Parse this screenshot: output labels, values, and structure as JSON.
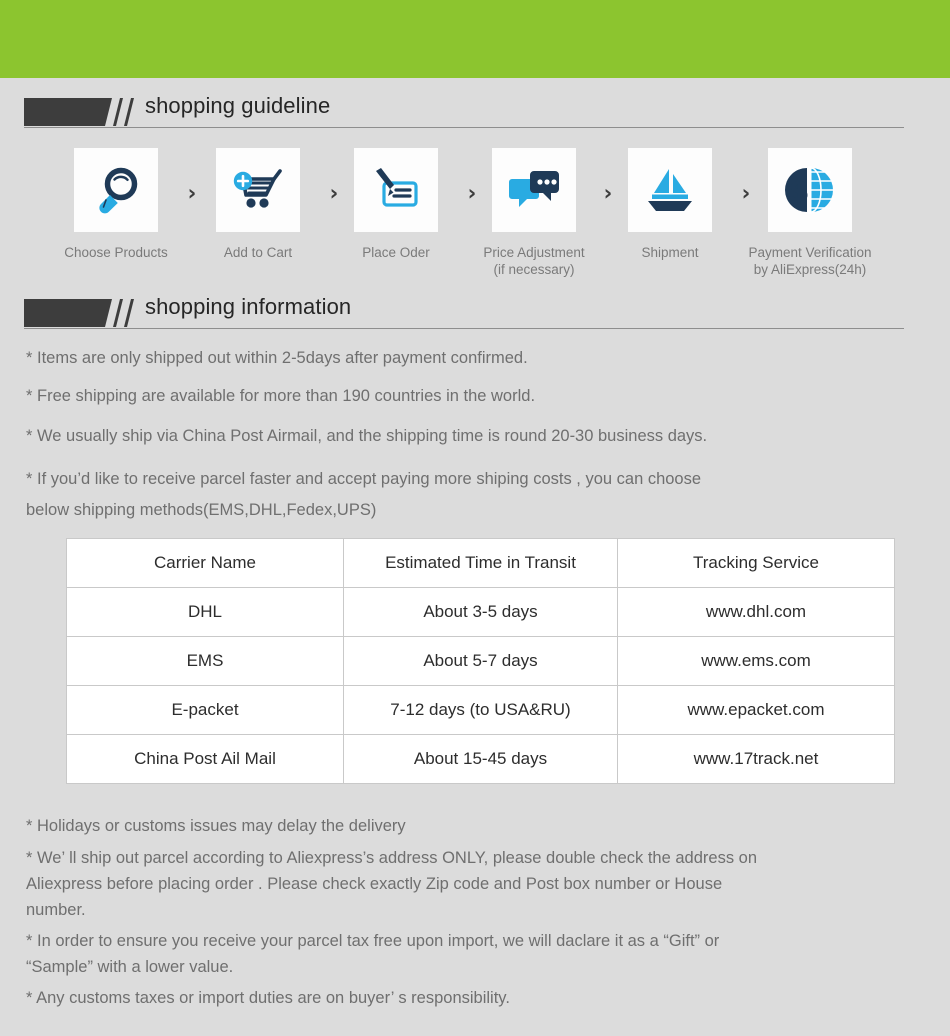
{
  "theme": {
    "banner_color": "#8cc52f",
    "background_color": "#dcdcdc",
    "icon_dark": "#1f3a57",
    "icon_blue": "#29abe2",
    "text_gray": "#6f6f6f",
    "heading_dark": "#3d3d3d"
  },
  "sections": {
    "guideline": {
      "title": "shopping guideline"
    },
    "information": {
      "title": "shopping information"
    }
  },
  "steps": [
    {
      "icon": "magnifier-icon",
      "label": "Choose Products"
    },
    {
      "icon": "shopping-cart-plus-icon",
      "label": "Add to Cart"
    },
    {
      "icon": "pen-check-icon",
      "label": "Place Oder"
    },
    {
      "icon": "chat-bubbles-icon",
      "label": "Price Adjustment\n(if necessary)"
    },
    {
      "icon": "sailboat-icon",
      "label": "Shipment"
    },
    {
      "icon": "dollar-globe-icon",
      "label": "Payment Verification\nby AliExpress(24h)"
    }
  ],
  "step_separator": "›",
  "info_bullets": [
    "* Items are only shipped out within 2-5days after payment confirmed.",
    "* Free shipping are available for more than 190 countries in the world.",
    "* We usually ship via China Post Airmail, and the shipping time is round 20-30 business days.",
    "* If you’d like to receive parcel faster and accept paying more shiping costs , you can choose\n  below shipping methods(EMS,DHL,Fedex,UPS)"
  ],
  "table": {
    "headers": [
      "Carrier Name",
      "Estimated Time in Transit",
      "Tracking Service"
    ],
    "rows": [
      [
        "DHL",
        "About 3-5 days",
        "www.dhl.com"
      ],
      [
        "EMS",
        "About 5-7 days",
        "www.ems.com"
      ],
      [
        "E-packet",
        "7-12 days (to USA&RU)",
        "www.epacket.com"
      ],
      [
        "China Post Ail Mail",
        "About 15-45 days",
        "www.17track.net"
      ]
    ]
  },
  "footer_notes": [
    "* Holidays or customs issues may delay the delivery",
    "* We’ ll ship out parcel according to Aliexpress’s address ONLY, please double check the address on\n  Aliexpress before placing order . Please check exactly Zip code and Post box  number or House\n  number.",
    "* In order to ensure you receive your parcel tax free upon import, we will daclare it as a  “Gift”  or\n  “Sample”  with a lower value.",
    "* Any customs taxes or import duties are on buyer’ s responsibility."
  ]
}
